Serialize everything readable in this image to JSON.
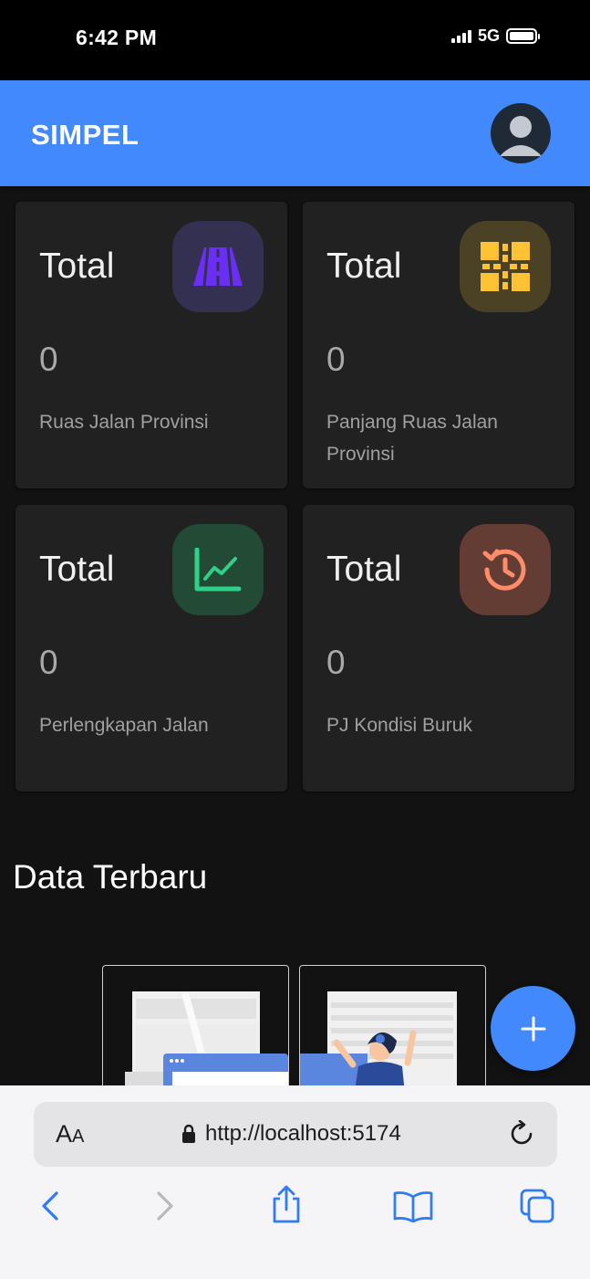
{
  "status_bar": {
    "time": "6:42 PM",
    "network": "5G"
  },
  "app_bar": {
    "title": "SIMPEL",
    "avatar_icon": "user-avatar-icon"
  },
  "cards": [
    {
      "total_label": "Total",
      "value": "0",
      "label": "Ruas Jalan Provinsi",
      "icon": "road-icon",
      "icon_color": "#6a2ef5",
      "icon_bg": "#343052"
    },
    {
      "total_label": "Total",
      "value": "0",
      "label": "Panjang Ruas Jalan Provinsi",
      "icon": "crossroad-icon",
      "icon_color": "#ffc234",
      "icon_bg": "#4b4124"
    },
    {
      "total_label": "Total",
      "value": "0",
      "label": "Perlengkapan Jalan",
      "icon": "line-chart-icon",
      "icon_color": "#2fd08a",
      "icon_bg": "#224a35"
    },
    {
      "total_label": "Total",
      "value": "0",
      "label": "PJ Kondisi Buruk",
      "icon": "history-clock-icon",
      "icon_color": "#ff8c68",
      "icon_bg": "#633c33"
    }
  ],
  "section": {
    "title": "Data Terbaru"
  },
  "fab": {
    "icon": "plus-icon"
  },
  "browser": {
    "text_size_big": "A",
    "text_size_small": "A",
    "url": "http://localhost:5174",
    "tools": [
      "back-icon",
      "forward-icon",
      "share-icon",
      "bookmarks-icon",
      "tabs-icon"
    ]
  },
  "colors": {
    "primary": "#4289fd",
    "background": "#121212",
    "card": "#212121"
  }
}
